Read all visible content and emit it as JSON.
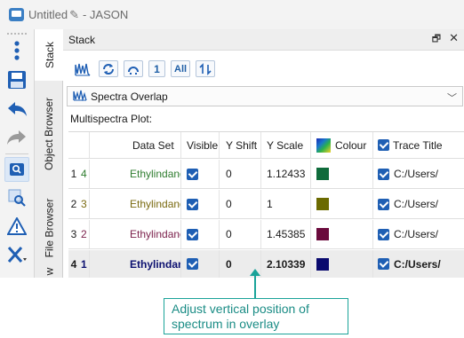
{
  "window": {
    "title": "Untitled",
    "title_suffix": " - JASON"
  },
  "panel": {
    "title": "Stack"
  },
  "vtabs": [
    {
      "label": "Stack"
    },
    {
      "label": "Object Browser"
    },
    {
      "label": "File Browser"
    },
    {
      "label": "w"
    }
  ],
  "icons": {
    "one_label": "1",
    "all_label": "All"
  },
  "combo": {
    "selected": "Spectra Overlap"
  },
  "multispectra_label": "Multispectra Plot:",
  "table": {
    "headers": {
      "num": "#",
      "dataset": "Data Set",
      "visible": "Visible",
      "yshift": "Y Shift",
      "yscale": "Y Scale",
      "colour": "Colour",
      "trace_title": "Trace Title"
    },
    "rows": [
      {
        "idx": "1",
        "num": "4",
        "dataset": "Ethylindanone",
        "yshift": "0",
        "yscale": "1.12433",
        "color": "#0f6b3b",
        "trace": "C:/Users/",
        "num_color": "#2f7d2f",
        "ds_color": "#2f7d2f"
      },
      {
        "idx": "2",
        "num": "3",
        "dataset": "Ethylindanone",
        "yshift": "0",
        "yscale": "1",
        "color": "#6b6a00",
        "trace": "C:/Users/",
        "num_color": "#7a6a10",
        "ds_color": "#7a6a10"
      },
      {
        "idx": "3",
        "num": "2",
        "dataset": "Ethylindanone",
        "yshift": "0",
        "yscale": "1.45385",
        "color": "#6a0a3c",
        "trace": "C:/Users/",
        "num_color": "#7a1f4a",
        "ds_color": "#7a1f4a"
      },
      {
        "idx": "4",
        "num": "1",
        "dataset": "Ethylindanone",
        "yshift": "0",
        "yscale": "2.10339",
        "color": "#0a0a6e",
        "trace": "C:/Users/",
        "num_color": "#0c1070",
        "ds_color": "#0c1070"
      }
    ]
  },
  "annotation": {
    "line1": "Adjust vertical position of",
    "line2": "spectrum in overlay"
  },
  "colors": {
    "accent": "#1aa399",
    "check": "#1f5fb4"
  }
}
